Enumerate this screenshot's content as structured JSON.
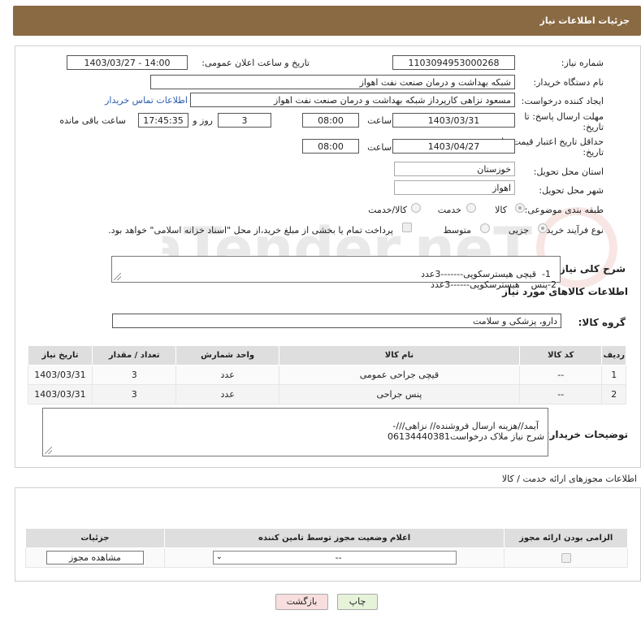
{
  "header": {
    "title": "جزئیات اطلاعات نیاز"
  },
  "form": {
    "need_number_label": "شماره نیاز:",
    "need_number": "1103094953000268",
    "announce_label": "تاریخ و ساعت اعلان عمومی:",
    "announce_value": "1403/03/27 - 14:00",
    "buyer_org_label": "نام دستگاه خریدار:",
    "buyer_org": "شبکه بهداشت و درمان صنعت نفت اهواز",
    "requester_label": "ایجاد کننده درخواست:",
    "requester": "مسعود نزاهی کارپرداز شبکه بهداشت و درمان صنعت نفت اهواز",
    "contact_link": "اطلاعات تماس خریدار",
    "deadline_label_1": "مهلت ارسال پاسخ: تا",
    "deadline_label_2": "تاریخ:",
    "deadline_date": "1403/03/31",
    "time_label": "ساعت",
    "deadline_time": "08:00",
    "days_value": "3",
    "days_label": "روز و",
    "remaining_time": "17:45:35",
    "remaining_label": "ساعت باقی مانده",
    "validity_label_1": "حداقل تاریخ اعتبار قیمت: تا",
    "validity_label_2": "تاریخ:",
    "validity_date": "1403/04/27",
    "validity_time": "08:00",
    "province_label": "استان محل تحویل:",
    "province": "خوزستان",
    "city_label": "شهر محل تحویل:",
    "city": "اهواز",
    "category_label": "طبقه بندی موضوعی:",
    "category_options": [
      "کالا",
      "خدمت",
      "کالا/خدمت"
    ],
    "process_label": "نوع فرآیند خرید :",
    "process_options": [
      "جزیی",
      "متوسط"
    ],
    "payment_note": "پرداخت تمام یا بخشی از مبلغ خرید،از محل \"اسناد خزانه اسلامی\" خواهد بود.",
    "summary_label": "شرح کلی نیاز:",
    "summary_text": "1-  قیچی هیسترسکوپی-------3عدد\n2-پنس    هیسترسکوپی------3عدد",
    "goods_info_title": "اطلاعات کالاهای مورد نیاز",
    "goods_group_label": "گروه کالا:",
    "goods_group": "دارو، پزشکی و سلامت",
    "buyer_notes_label": "توضیحات خریدار:",
    "buyer_notes": "آیمد//هزینه ارسال فروشنده// نزاهی///-\nشرح نیاز ملاک درخواست06134440381"
  },
  "goods_table": {
    "headers": [
      "ردیف",
      "کد کالا",
      "نام کالا",
      "واحد شمارش",
      "تعداد / مقدار",
      "تاریخ نیاز"
    ],
    "rows": [
      [
        "1",
        "--",
        "قیچی جراحی عمومی",
        "عدد",
        "3",
        "1403/03/31"
      ],
      [
        "2",
        "--",
        "پنس جراحی",
        "عدد",
        "3",
        "1403/03/31"
      ]
    ]
  },
  "permits": {
    "title": "اطلاعات مجوزهای ارائه خدمت / کالا",
    "headers": [
      "الزامی بودن ارائه مجوز",
      "اعلام وضعیت مجوز توسط تامین کننده",
      "جزئیات"
    ],
    "select_value": "--",
    "view_button": "مشاهده مجوز"
  },
  "footer": {
    "print_button": "چاپ",
    "back_button": "بازگشت"
  },
  "watermark": {
    "text": "AriaTender.neT"
  },
  "colors": {
    "header": "#8a6a43",
    "link": "#2a5db0",
    "back_button": "#f8dede",
    "print_button": "#e6f3d9"
  }
}
